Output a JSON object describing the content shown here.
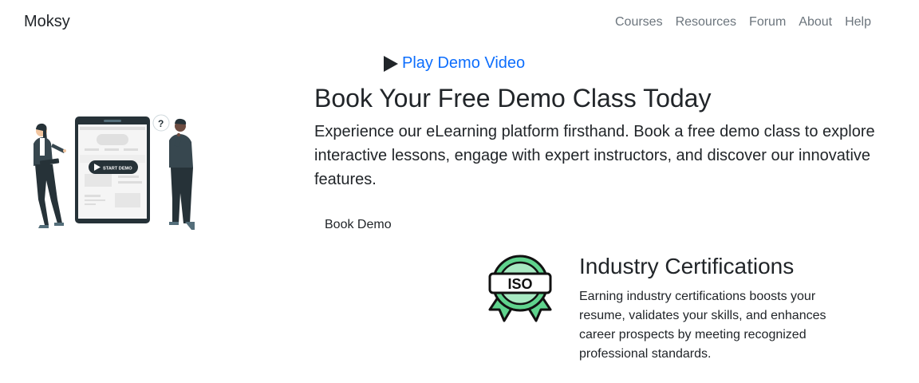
{
  "nav": {
    "brand": "Moksy",
    "links": [
      "Courses",
      "Resources",
      "Forum",
      "About",
      "Help"
    ]
  },
  "hero": {
    "play_label": "Play Demo Video",
    "title": "Book Your Free Demo Class Today",
    "description": "Experience our eLearning platform firsthand. Book a free demo class to explore interactive lessons, engage with expert instructors, and discover our innovative features.",
    "button_label": "Book Demo",
    "illustration_badge": "START DEMO",
    "illustration_question": "?"
  },
  "feature": {
    "badge_text": "ISO",
    "title": "Industry Certifications",
    "description": "Earning industry certifications boosts your resume, validates your skills, and enhances career prospects by meeting recognized professional standards."
  },
  "colors": {
    "link": "#0d6efd",
    "nav_link": "#6c757d",
    "text": "#212529",
    "badge_green": "#5fd38d"
  },
  "icons": [
    "play-icon",
    "iso-badge-icon"
  ]
}
